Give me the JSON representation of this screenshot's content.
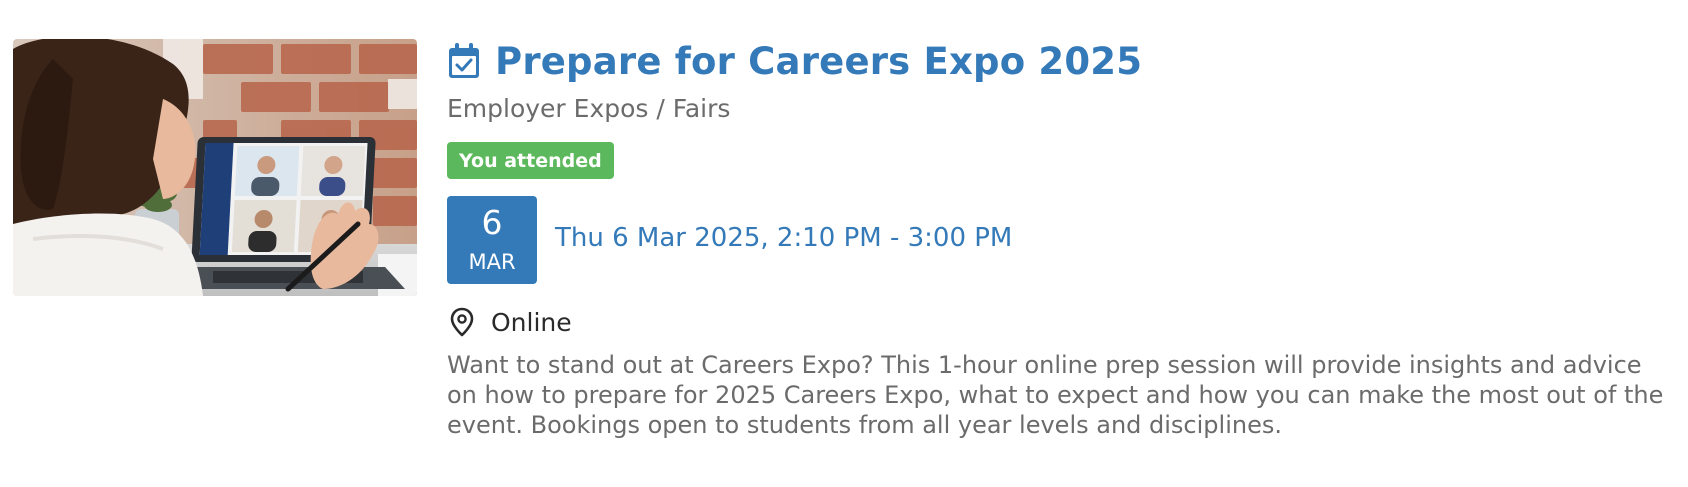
{
  "event": {
    "title": "Prepare for Careers Expo 2025",
    "category": "Employer Expos / Fairs",
    "attendance_badge": "You attended",
    "date_day": "6",
    "date_month": "MAR",
    "datetime": "Thu 6 Mar 2025, 2:10 PM - 3:00 PM",
    "location": "Online",
    "description": "Want to stand out at Careers Expo? This 1-hour online prep session will provide insights and advice on how to prepare for 2025 Careers Expo, what to expect and how you can make the most out of the event. Bookings open to students from all year levels and disciplines."
  },
  "icons": {
    "title_icon": "calendar-check-icon",
    "location_icon": "map-pin-icon"
  },
  "colors": {
    "accent": "#3479b8",
    "badge_success": "#5cb85c",
    "muted_text": "#6b6b6b",
    "body_text": "#2a2a2a"
  }
}
